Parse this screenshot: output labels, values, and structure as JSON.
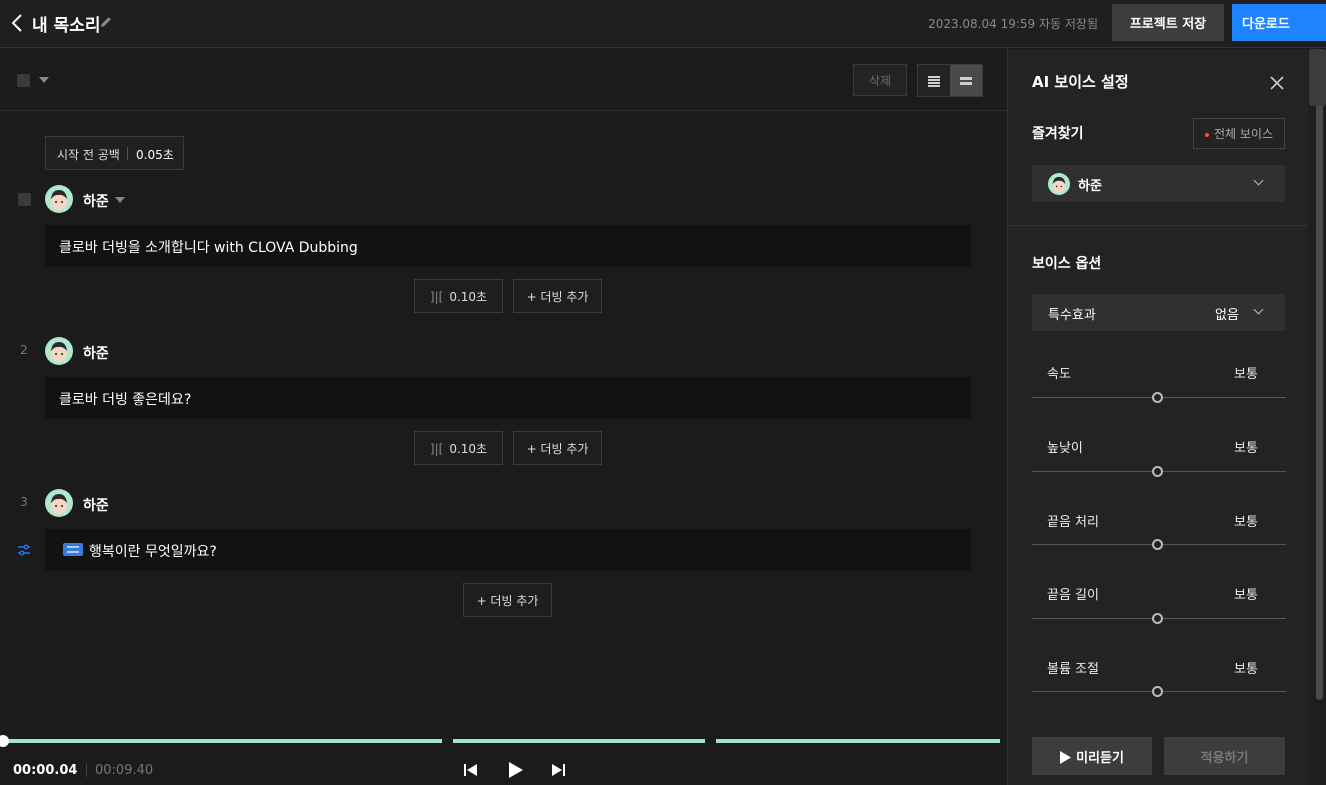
{
  "header": {
    "title": "내 목소리",
    "autosave": "2023.08.04 19:59 자동 저장됨",
    "save_label": "프로젝트 저장",
    "download_label": "다운로드"
  },
  "toolbar": {
    "delete_label": "삭제"
  },
  "start_pad": {
    "label": "시작 전 공백",
    "value": "0.05초"
  },
  "rows": [
    {
      "num": "",
      "speaker": "하준",
      "text": "클로바 더빙을 소개합니다 with CLOVA Dubbing",
      "pause_icon": "]|[",
      "pause": "0.10초",
      "add": "+ 더빙 추가"
    },
    {
      "num": "2",
      "speaker": "하준",
      "text": "클로바 더빙 좋은데요?",
      "pause_icon": "]|[",
      "pause": "0.10초",
      "add": "+ 더빙 추가"
    },
    {
      "num": "3",
      "speaker": "하준",
      "text": "행복이란 무엇일까요?",
      "add": "+ 더빙 추가"
    }
  ],
  "player": {
    "current": "00:00.04",
    "total": "00:09.40"
  },
  "panel": {
    "title": "AI 보이스 설정",
    "favorites_label": "즐겨찾기",
    "all_voices_label": "전체 보이스",
    "selected_voice": "하준",
    "voice_options_label": "보이스 옵션",
    "effect_label": "특수효과",
    "effect_value": "없음",
    "options": [
      {
        "name": "속도",
        "value": "보통"
      },
      {
        "name": "높낮이",
        "value": "보통"
      },
      {
        "name": "끝음 처리",
        "value": "보통"
      },
      {
        "name": "끝음 길이",
        "value": "보통"
      },
      {
        "name": "볼륨 조절",
        "value": "보통"
      }
    ],
    "preview_label": "미리듣기",
    "apply_label": "적용하기"
  },
  "colors": {
    "accent": "#1d83ff",
    "timeline": "#9ee8c6",
    "avatar_bg": "#aee8cf"
  }
}
